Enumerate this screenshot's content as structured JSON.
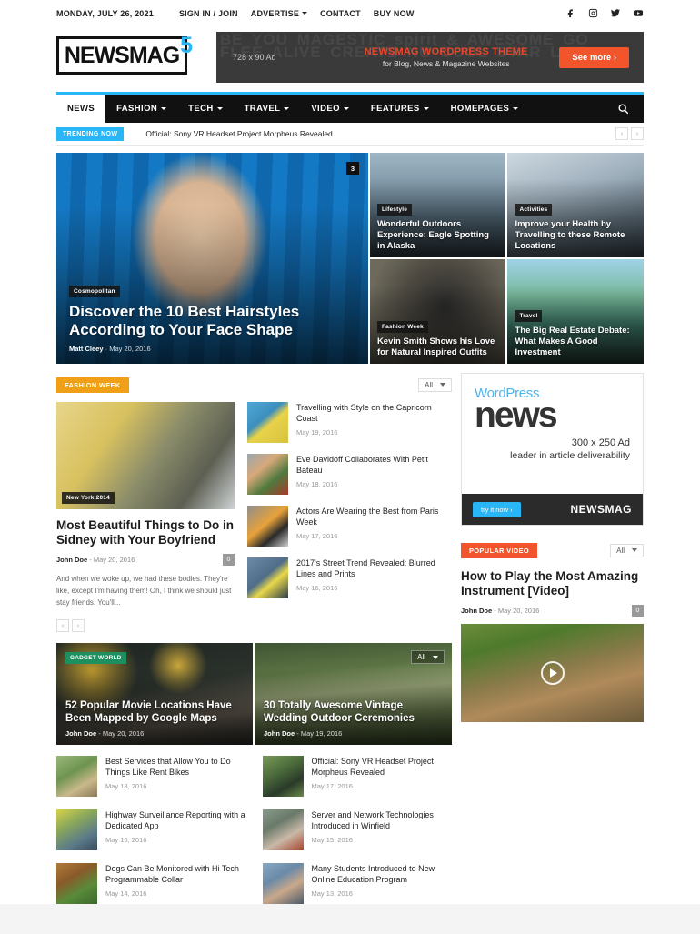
{
  "topbar": {
    "date": "MONDAY, JULY 26, 2021",
    "links": [
      {
        "label": "SIGN IN / JOIN",
        "caret": false
      },
      {
        "label": "ADVERTISE",
        "caret": true
      },
      {
        "label": "CONTACT",
        "caret": false
      },
      {
        "label": "BUY NOW",
        "caret": false
      }
    ],
    "social": [
      "facebook-icon",
      "instagram-icon",
      "twitter-icon",
      "youtube-icon"
    ]
  },
  "header": {
    "logo_text": "NEWSMAG",
    "logo_sup": "5",
    "ad": {
      "size_label": "728 x 90 Ad",
      "headline": "NEWSMAG WORDPRESS THEME",
      "subline": "for Blog, News & Magazine Websites",
      "button": "See more  ›",
      "ghost_text": "BE YOU MAGESTIC spirit & AWESOME GO FLEE ALIVE CREATE NU COOL STAR LIFE"
    }
  },
  "nav": {
    "items": [
      {
        "label": "NEWS",
        "active": true,
        "caret": false
      },
      {
        "label": "FASHION",
        "active": false,
        "caret": true
      },
      {
        "label": "TECH",
        "active": false,
        "caret": true
      },
      {
        "label": "TRAVEL",
        "active": false,
        "caret": true
      },
      {
        "label": "VIDEO",
        "active": false,
        "caret": true
      },
      {
        "label": "FEATURES",
        "active": false,
        "caret": true
      },
      {
        "label": "HOMEPAGES",
        "active": false,
        "caret": true
      }
    ],
    "search_icon": "search-icon"
  },
  "trending": {
    "badge": "TRENDING NOW",
    "text": "Official: Sony VR Headset Project Morpheus Revealed",
    "prev": "‹",
    "next": "›"
  },
  "hero": {
    "main": {
      "category": "Cosmopolitan",
      "title": "Discover the 10 Best Hairstyles According to Your Face Shape",
      "author": "Matt Cleey",
      "date": "May 20, 2016",
      "comments": "3"
    },
    "cells": [
      {
        "category": "Lifestyle",
        "title": "Wonderful Outdoors Experience: Eagle Spotting in Alaska"
      },
      {
        "category": "Activities",
        "title": "Improve your Health by Travelling to these Remote Locations"
      },
      {
        "category": "Fashion week",
        "title": "Kevin Smith Shows his Love for Natural Inspired Outfits"
      },
      {
        "category": "Travel",
        "title": "The Big Real Estate Debate: What Makes A Good Investment"
      }
    ]
  },
  "fashion_week": {
    "badge": "FASHION WEEK",
    "badge_color": "#f0a017",
    "filter": "All",
    "feature": {
      "category": "New York 2014",
      "title": "Most Beautiful Things to Do in Sidney with Your Boyfriend",
      "author": "John Doe",
      "date": "May 20, 2016",
      "comments": "0",
      "excerpt": "And when we woke up, we had these bodies. They're like, except I'm having them! Oh, I think we should just stay friends. You'll..."
    },
    "items": [
      {
        "title": "Travelling with Style on the Capricorn Coast",
        "date": "May 19, 2016"
      },
      {
        "title": "Eve Davidoff Collaborates With Petit Bateau",
        "date": "May 18, 2016"
      },
      {
        "title": "Actors Are Wearing the Best from Paris Week",
        "date": "May 17, 2016"
      },
      {
        "title": "2017's Street Trend Revealed: Blurred Lines and Prints",
        "date": "May 16, 2016"
      }
    ],
    "prev": "‹",
    "next": "›"
  },
  "gadget_world": {
    "badge": "GADGET WORLD",
    "badge_color": "#1e8f5e",
    "filter": "All",
    "cards": [
      {
        "title": "52 Popular Movie Locations Have Been Mapped by Google Maps",
        "author": "John Doe",
        "date": "May 20, 2016"
      },
      {
        "title": "30 Totally Awesome Vintage Wedding Outdoor Ceremonies",
        "author": "John Doe",
        "date": "May 19, 2016"
      }
    ],
    "left_items": [
      {
        "title": "Best Services that Allow You to Do Things Like Rent Bikes",
        "date": "May 18, 2016"
      },
      {
        "title": "Highway Surveillance Reporting with a Dedicated App",
        "date": "May 16, 2016"
      },
      {
        "title": "Dogs Can Be Monitored with Hi Tech Programmable Collar",
        "date": "May 14, 2016"
      }
    ],
    "right_items": [
      {
        "title": "Official: Sony VR Headset Project Morpheus Revealed",
        "date": "May 17, 2016"
      },
      {
        "title": "Server and Network Technologies Introduced in Winfield",
        "date": "May 15, 2016"
      },
      {
        "title": "Many Students Introduced to New Online Education Program",
        "date": "May 13, 2016"
      }
    ]
  },
  "sidebar": {
    "ad": {
      "wordpress": "WordPress",
      "news": "news",
      "size_label": "300 x 250 Ad",
      "tagline": "leader in article deliverability",
      "try_button": "try it now ›",
      "brand": "NEWSMAG"
    },
    "popular_video": {
      "badge": "POPULAR VIDEO",
      "badge_color": "#f2552c",
      "filter": "All",
      "title": "How to Play the Most Amazing Instrument [Video]",
      "author": "John Doe",
      "date": "May 20, 2016",
      "comments": "0",
      "play_icon": "play-icon"
    }
  },
  "colors": {
    "accent_blue": "#29b6f6",
    "accent_orange": "#f2552c",
    "nav_dark": "#111111"
  }
}
